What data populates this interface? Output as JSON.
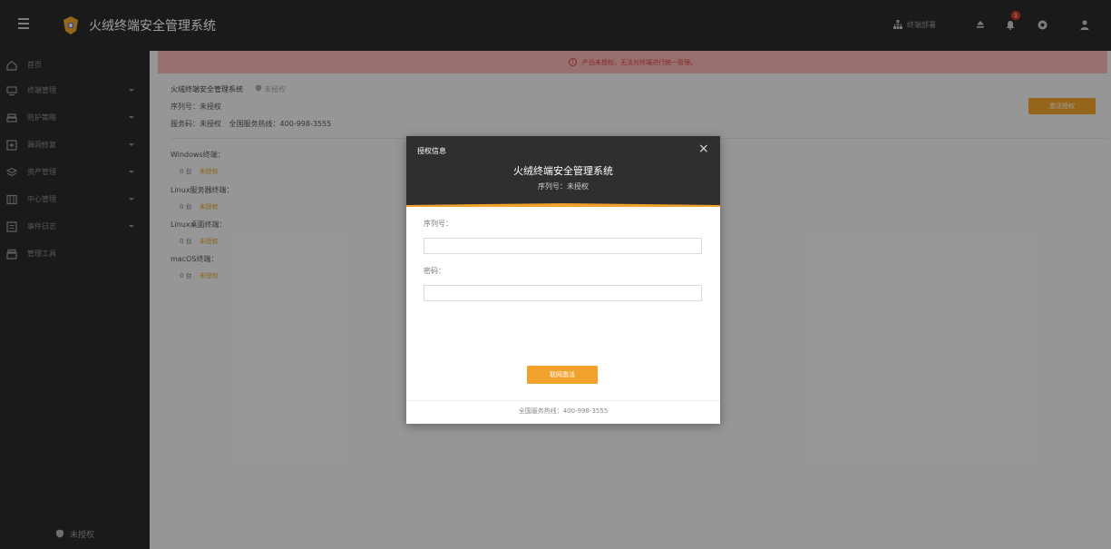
{
  "header": {
    "app_title": "火绒终端安全管理系统",
    "deploy_label": "终端部署",
    "notification_count": "1"
  },
  "sidebar": {
    "items": [
      {
        "label": "首页",
        "icon": "home-icon",
        "has_arrow": false
      },
      {
        "label": "终端管理",
        "icon": "monitor-icon",
        "has_arrow": true
      },
      {
        "label": "防护策略",
        "icon": "shield-policy-icon",
        "has_arrow": true
      },
      {
        "label": "漏洞修复",
        "icon": "patch-icon",
        "has_arrow": true
      },
      {
        "label": "资产管理",
        "icon": "asset-icon",
        "has_arrow": true
      },
      {
        "label": "中心管理",
        "icon": "center-icon",
        "has_arrow": true
      },
      {
        "label": "事件日志",
        "icon": "log-icon",
        "has_arrow": true
      },
      {
        "label": "管理工具",
        "icon": "toolbox-icon",
        "has_arrow": false
      }
    ],
    "footer_label": "未授权"
  },
  "content": {
    "warning": "产品未授权，无法对终端进行统一管理。",
    "product_name": "火绒终端安全管理系统",
    "product_status": "未授权",
    "serial_line": "序列号：未授权",
    "service_line": "服务码：未授权",
    "hotline_line": "全国服务热线：400-998-3555",
    "activate_button": "激活授权",
    "os_list": [
      {
        "name": "Windows终端：",
        "count": "0 台",
        "status": "未授权"
      },
      {
        "name": "Linux服务器终端：",
        "count": "0 台",
        "status": "未授权"
      },
      {
        "name": "Linux桌面终端：",
        "count": "0 台",
        "status": "未授权"
      },
      {
        "name": "macOS终端：",
        "count": "0 台",
        "status": "未授权"
      }
    ]
  },
  "modal": {
    "title": "授权信息",
    "close": "×",
    "app_name": "火绒终端安全管理系统",
    "serial": "序列号：未授权",
    "serial_label": "序列号：",
    "serial_value": "",
    "password_label": "密码：",
    "password_value": "",
    "online_button": "联网激活",
    "footer": "全国服务热线：400-998-3555"
  },
  "colors": {
    "accent": "#f2a22c",
    "dark": "#2b2b2b",
    "warning_bg": "#f7b5b5",
    "warning_text": "#d6453d"
  }
}
